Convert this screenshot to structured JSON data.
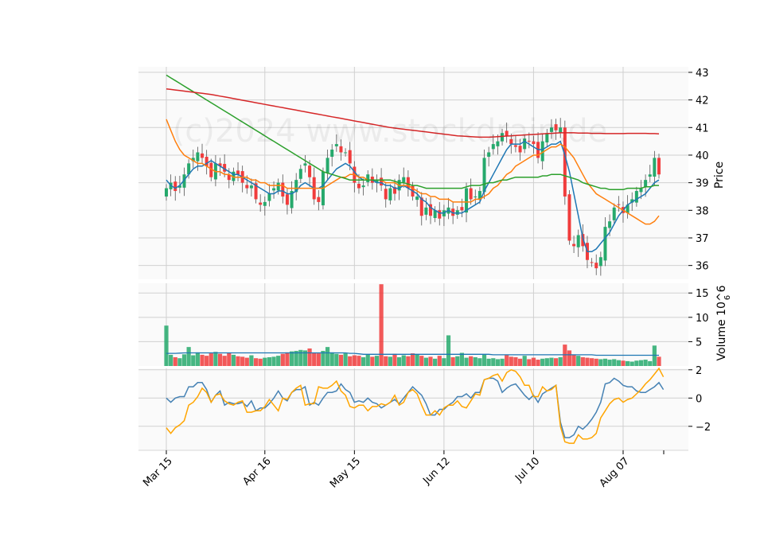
{
  "watermark": "(c)2024 www.stockdrain.de",
  "x_ticks": [
    "Mar 15",
    "Apr 16",
    "May 15",
    "Jun 12",
    "Jul 10",
    "Aug 07"
  ],
  "colors": {
    "up": "#26a96c",
    "down": "#f03c3c",
    "sma_short": "#1f77b4",
    "sma_mid": "#ff7f0e",
    "sma_long": "#2ca02c",
    "sma_200": "#d62728",
    "osc_a": "#4682b4",
    "osc_b": "#ffa500",
    "grid": "#d0d0d0",
    "panel_bg": "#fafafa"
  },
  "chart_data": [
    {
      "type": "candlestick",
      "panel": "price",
      "ylabel": "Price",
      "ylim": [
        35.5,
        43.2
      ],
      "yticks": [
        36,
        37,
        38,
        39,
        40,
        41,
        42,
        43
      ],
      "close": [
        38.8,
        39.0,
        38.7,
        38.9,
        39.3,
        39.7,
        39.9,
        40.1,
        39.9,
        39.6,
        39.2,
        39.7,
        39.6,
        39.4,
        39.1,
        39.4,
        39.3,
        39.0,
        38.8,
        38.9,
        38.4,
        38.2,
        38.3,
        38.6,
        38.8,
        39.0,
        38.5,
        38.2,
        38.7,
        39.1,
        39.5,
        39.7,
        39.2,
        38.4,
        38.3,
        39.4,
        39.9,
        40.2,
        40.4,
        40.1,
        40.1,
        39.7,
        39.0,
        38.8,
        38.9,
        39.3,
        39.0,
        39.1,
        38.9,
        38.4,
        38.8,
        38.6,
        39.1,
        39.2,
        38.8,
        38.5,
        38.5,
        37.8,
        38.1,
        37.8,
        38.0,
        37.7,
        38.0,
        38.1,
        37.8,
        38.0,
        38.0,
        38.8,
        38.4,
        38.5,
        38.7,
        39.9,
        40.1,
        40.4,
        40.5,
        40.8,
        40.7,
        40.4,
        40.3,
        40.1,
        40.6,
        40.5,
        40.4,
        39.9,
        40.5,
        40.8,
        41.0,
        40.9,
        41.0,
        38.5,
        36.9,
        36.7,
        37.1,
        36.7,
        36.2,
        36.1,
        35.9,
        36.3,
        37.4,
        37.6,
        38.1,
        38.2,
        37.9,
        38.2,
        38.4,
        38.7,
        38.8,
        39.1,
        39.3,
        39.9,
        39.3
      ],
      "series": [
        {
          "name": "",
          "values": [
            39.1,
            38.9,
            38.8,
            38.9,
            39.1,
            39.3,
            39.5,
            39.6,
            39.6,
            39.7,
            39.8,
            39.7,
            39.6,
            39.5,
            39.4,
            39.3,
            39.3,
            39.2,
            39.1,
            39.0,
            38.9,
            38.8,
            38.7,
            38.6,
            38.6,
            38.7,
            38.7,
            38.6,
            38.6,
            38.7,
            38.9,
            39.0,
            38.9,
            38.8,
            38.8,
            38.9,
            39.1,
            39.3,
            39.5,
            39.6,
            39.7,
            39.6,
            39.4,
            39.2,
            39.1,
            39.1,
            39.1,
            39.0,
            39.0,
            38.9,
            38.9,
            38.8,
            38.8,
            38.9,
            38.8,
            38.7,
            38.6,
            38.4,
            38.3,
            38.1,
            38.0,
            37.9,
            37.9,
            38.0,
            37.9,
            37.9,
            37.9,
            38.0,
            38.1,
            38.2,
            38.3,
            38.7,
            39.0,
            39.3,
            39.6,
            39.9,
            40.2,
            40.4,
            40.4,
            40.4,
            40.5,
            40.4,
            40.3,
            40.2,
            40.2,
            40.3,
            40.4,
            40.4,
            40.5,
            40.0,
            39.4,
            38.6,
            37.8,
            37.0,
            36.5,
            36.5,
            36.6,
            36.8,
            37.0,
            37.2,
            37.5,
            37.8,
            38.0,
            38.2,
            38.3,
            38.4,
            38.5,
            38.6,
            38.8,
            39.0,
            39.1
          ]
        },
        {
          "name": "",
          "values": [
            41.3,
            40.9,
            40.5,
            40.2,
            40.0,
            39.9,
            39.8,
            39.7,
            39.7,
            39.6,
            39.5,
            39.4,
            39.4,
            39.3,
            39.3,
            39.2,
            39.2,
            39.2,
            39.2,
            39.1,
            39.1,
            39.0,
            39.0,
            38.9,
            38.9,
            38.9,
            38.9,
            38.8,
            38.8,
            38.8,
            38.8,
            38.8,
            38.8,
            38.8,
            38.8,
            38.8,
            38.9,
            39.0,
            39.1,
            39.2,
            39.2,
            39.3,
            39.3,
            39.2,
            39.2,
            39.1,
            39.1,
            39.1,
            39.1,
            39.0,
            39.0,
            39.0,
            38.9,
            38.9,
            38.9,
            38.8,
            38.7,
            38.6,
            38.6,
            38.5,
            38.5,
            38.4,
            38.4,
            38.4,
            38.3,
            38.3,
            38.3,
            38.3,
            38.3,
            38.4,
            38.4,
            38.5,
            38.6,
            38.8,
            38.9,
            39.1,
            39.3,
            39.4,
            39.6,
            39.7,
            39.8,
            39.9,
            40.0,
            40.0,
            40.1,
            40.2,
            40.3,
            40.3,
            40.4,
            40.3,
            40.1,
            39.9,
            39.6,
            39.3,
            39.0,
            38.8,
            38.6,
            38.5,
            38.4,
            38.3,
            38.2,
            38.1,
            38.0,
            37.9,
            37.8,
            37.7,
            37.6,
            37.5,
            37.5,
            37.6,
            37.8
          ]
        },
        {
          "name": "",
          "values": [
            42.9,
            42.8,
            42.7,
            42.6,
            42.5,
            42.4,
            42.3,
            42.2,
            42.1,
            42.0,
            41.9,
            41.8,
            41.7,
            41.6,
            41.5,
            41.4,
            41.3,
            41.2,
            41.1,
            41.0,
            40.9,
            40.8,
            40.7,
            40.6,
            40.5,
            40.4,
            40.3,
            40.2,
            40.1,
            40.0,
            39.9,
            39.8,
            39.7,
            39.6,
            39.5,
            39.4,
            39.35,
            39.3,
            39.25,
            39.2,
            39.15,
            39.1,
            39.1,
            39.1,
            39.1,
            39.1,
            39.1,
            39.1,
            39.1,
            39.1,
            39.1,
            39.05,
            39.0,
            39.0,
            38.95,
            38.9,
            38.9,
            38.85,
            38.8,
            38.8,
            38.8,
            38.8,
            38.8,
            38.8,
            38.8,
            38.8,
            38.8,
            38.85,
            38.9,
            38.9,
            38.9,
            38.95,
            39.0,
            39.0,
            39.05,
            39.1,
            39.1,
            39.15,
            39.2,
            39.2,
            39.2,
            39.2,
            39.2,
            39.2,
            39.25,
            39.25,
            39.3,
            39.3,
            39.3,
            39.25,
            39.2,
            39.15,
            39.1,
            39.0,
            38.95,
            38.9,
            38.85,
            38.8,
            38.8,
            38.75,
            38.75,
            38.75,
            38.75,
            38.8,
            38.8,
            38.8,
            38.8,
            38.85,
            38.85,
            38.9,
            38.9
          ]
        },
        {
          "name": "",
          "values": [
            42.4,
            42.38,
            42.36,
            42.34,
            42.32,
            42.3,
            42.28,
            42.26,
            42.24,
            42.22,
            42.2,
            42.17,
            42.14,
            42.11,
            42.08,
            42.05,
            42.02,
            41.99,
            41.96,
            41.93,
            41.9,
            41.87,
            41.84,
            41.81,
            41.78,
            41.75,
            41.72,
            41.69,
            41.66,
            41.63,
            41.6,
            41.57,
            41.54,
            41.51,
            41.48,
            41.45,
            41.42,
            41.39,
            41.36,
            41.33,
            41.3,
            41.27,
            41.24,
            41.21,
            41.18,
            41.15,
            41.12,
            41.09,
            41.06,
            41.03,
            41.0,
            40.98,
            40.96,
            40.94,
            40.92,
            40.9,
            40.88,
            40.86,
            40.84,
            40.82,
            40.8,
            40.78,
            40.76,
            40.74,
            40.72,
            40.7,
            40.69,
            40.68,
            40.67,
            40.66,
            40.65,
            40.65,
            40.65,
            40.66,
            40.67,
            40.68,
            40.69,
            40.7,
            40.71,
            40.72,
            40.73,
            40.74,
            40.75,
            40.76,
            40.77,
            40.78,
            40.79,
            40.8,
            40.81,
            40.81,
            40.81,
            40.81,
            40.8,
            40.8,
            40.8,
            40.79,
            40.79,
            40.79,
            40.78,
            40.78,
            40.78,
            40.78,
            40.78,
            40.79,
            40.79,
            40.79,
            40.79,
            40.79,
            40.78,
            40.78,
            40.77
          ]
        }
      ]
    },
    {
      "type": "bar",
      "panel": "volume",
      "ylabel": "Volume  10^6",
      "ylim": [
        0,
        17
      ],
      "yticks": [
        5,
        10,
        15
      ],
      "values": [
        8.3,
        2.3,
        1.8,
        1.6,
        2.4,
        3.9,
        2.2,
        2.8,
        2.3,
        2.1,
        2.6,
        2.9,
        2.5,
        2.1,
        2.7,
        2.3,
        2.0,
        1.9,
        1.7,
        2.2,
        1.6,
        1.5,
        1.7,
        1.8,
        1.9,
        2.1,
        2.5,
        2.8,
        3.0,
        3.1,
        3.3,
        3.2,
        3.6,
        2.7,
        2.6,
        3.1,
        3.9,
        2.8,
        2.5,
        2.3,
        2.6,
        2.0,
        2.2,
        2.1,
        1.8,
        2.4,
        1.9,
        2.1,
        16.8,
        2.0,
        1.9,
        2.5,
        1.8,
        2.2,
        2.0,
        2.6,
        2.4,
        2.1,
        1.7,
        1.9,
        1.5,
        2.1,
        1.6,
        6.3,
        1.8,
        2.0,
        2.7,
        1.7,
        2.0,
        1.8,
        1.6,
        2.4,
        1.5,
        1.6,
        1.4,
        1.5,
        2.2,
        1.9,
        1.8,
        1.5,
        2.1,
        1.4,
        1.7,
        1.3,
        1.5,
        1.6,
        1.7,
        1.6,
        1.8,
        4.4,
        3.2,
        2.3,
        2.1,
        1.8,
        1.7,
        1.6,
        1.5,
        1.4,
        1.5,
        1.3,
        1.4,
        1.2,
        1.1,
        1.0,
        0.9,
        1.1,
        1.2,
        1.3,
        1.0,
        4.2,
        1.9
      ],
      "average": [
        2.6,
        2.6,
        2.6,
        2.65,
        2.7,
        2.7,
        2.7,
        2.7,
        2.7,
        2.7,
        2.7,
        2.7,
        2.7,
        2.7,
        2.7,
        2.7,
        2.7,
        2.7,
        2.7,
        2.7,
        2.7,
        2.7,
        2.7,
        2.7,
        2.7,
        2.7,
        2.7,
        2.7,
        2.7,
        2.7,
        2.7,
        2.7,
        2.7,
        2.7,
        2.7,
        2.7,
        2.7,
        2.7,
        2.7,
        2.7,
        2.7,
        2.6,
        2.6,
        2.5,
        2.4,
        2.4,
        2.4,
        2.4,
        2.4,
        2.4,
        2.4,
        2.4,
        2.4,
        2.4,
        2.4,
        2.4,
        2.4,
        2.4,
        2.4,
        2.4,
        2.4,
        2.4,
        2.4,
        2.4,
        2.4,
        2.4,
        2.4,
        2.4,
        2.4,
        2.4,
        2.4,
        2.4,
        2.4,
        2.3,
        2.3,
        2.3,
        2.3,
        2.3,
        2.3,
        2.3,
        2.3,
        2.3,
        2.3,
        2.3,
        2.3,
        2.3,
        2.3,
        2.3,
        2.3,
        2.3,
        2.3,
        2.3,
        2.3,
        2.3,
        2.3,
        2.3,
        2.2,
        2.2,
        2.2,
        2.2,
        2.2,
        2.2,
        2.2,
        2.2,
        2.2,
        2.2,
        2.2,
        2.2,
        2.2,
        2.2,
        2.2
      ]
    },
    {
      "type": "line",
      "panel": "oscillator",
      "ylim": [
        -3.7,
        2.1
      ],
      "yticks": [
        -2,
        0,
        2
      ],
      "series": [
        {
          "name": "",
          "values": [
            0.0,
            -0.3,
            0.0,
            0.1,
            0.1,
            0.8,
            0.8,
            1.1,
            1.1,
            0.6,
            -0.3,
            0.2,
            0.5,
            -0.5,
            -0.3,
            -0.4,
            -0.4,
            -0.3,
            -0.6,
            -0.2,
            -0.9,
            -0.7,
            -0.7,
            -0.4,
            0.0,
            0.5,
            0.0,
            -0.2,
            0.4,
            0.6,
            0.6,
            0.8,
            -0.5,
            -0.3,
            -0.5,
            0.0,
            0.4,
            0.4,
            0.5,
            1.0,
            0.6,
            0.4,
            -0.3,
            -0.2,
            -0.3,
            0.0,
            -0.3,
            -0.4,
            -0.7,
            -0.5,
            -0.3,
            -0.1,
            -0.4,
            0.0,
            0.4,
            0.8,
            0.5,
            0.2,
            -0.4,
            -1.2,
            -1.2,
            -0.8,
            -0.8,
            -0.5,
            -0.3,
            0.1,
            0.1,
            0.3,
            0.0,
            0.4,
            0.4,
            1.3,
            1.4,
            1.4,
            1.2,
            0.4,
            0.7,
            0.9,
            1.0,
            0.6,
            0.2,
            -0.1,
            0.2,
            -0.3,
            0.3,
            0.5,
            0.7,
            0.9,
            -1.7,
            -2.8,
            -2.8,
            -2.6,
            -2.0,
            -2.2,
            -1.9,
            -1.5,
            -1.0,
            -0.3,
            1.0,
            1.1,
            1.4,
            1.2,
            0.9,
            0.8,
            0.8,
            0.5,
            0.4,
            0.4,
            0.6,
            0.8,
            1.1,
            0.6
          ]
        },
        {
          "name": "",
          "values": [
            -2.1,
            -2.5,
            -2.1,
            -1.9,
            -1.6,
            -0.5,
            -0.3,
            0.1,
            0.7,
            0.4,
            -0.3,
            0.2,
            0.3,
            -0.2,
            -0.4,
            -0.5,
            -0.3,
            -0.2,
            -1.0,
            -1.0,
            -0.9,
            -0.9,
            -0.6,
            -0.1,
            -0.5,
            -0.9,
            0.0,
            -0.1,
            0.4,
            0.7,
            0.9,
            -0.5,
            -0.4,
            -0.4,
            0.8,
            0.7,
            0.7,
            0.9,
            1.2,
            0.5,
            0.2,
            -0.6,
            -0.7,
            -0.5,
            -0.5,
            -0.9,
            -0.6,
            -0.6,
            -0.4,
            -0.5,
            -0.3,
            0.2,
            -0.5,
            -0.3,
            0.4,
            0.6,
            0.3,
            -0.5,
            -1.2,
            -1.2,
            -0.9,
            -1.2,
            -0.7,
            -0.5,
            -0.5,
            -0.2,
            -0.6,
            -0.7,
            -0.2,
            0.3,
            0.2,
            1.3,
            1.4,
            1.6,
            1.7,
            1.2,
            1.8,
            2.0,
            1.9,
            1.5,
            0.9,
            0.9,
            0.1,
            0.1,
            0.8,
            0.5,
            0.6,
            0.9,
            -2.0,
            -3.1,
            -3.2,
            -3.2,
            -2.6,
            -2.9,
            -2.9,
            -2.8,
            -2.5,
            -1.4,
            -0.9,
            -0.4,
            -0.1,
            0.0,
            -0.3,
            -0.1,
            0.0,
            0.3,
            0.6,
            1.0,
            1.3,
            1.7,
            2.1,
            1.5
          ]
        }
      ]
    }
  ]
}
